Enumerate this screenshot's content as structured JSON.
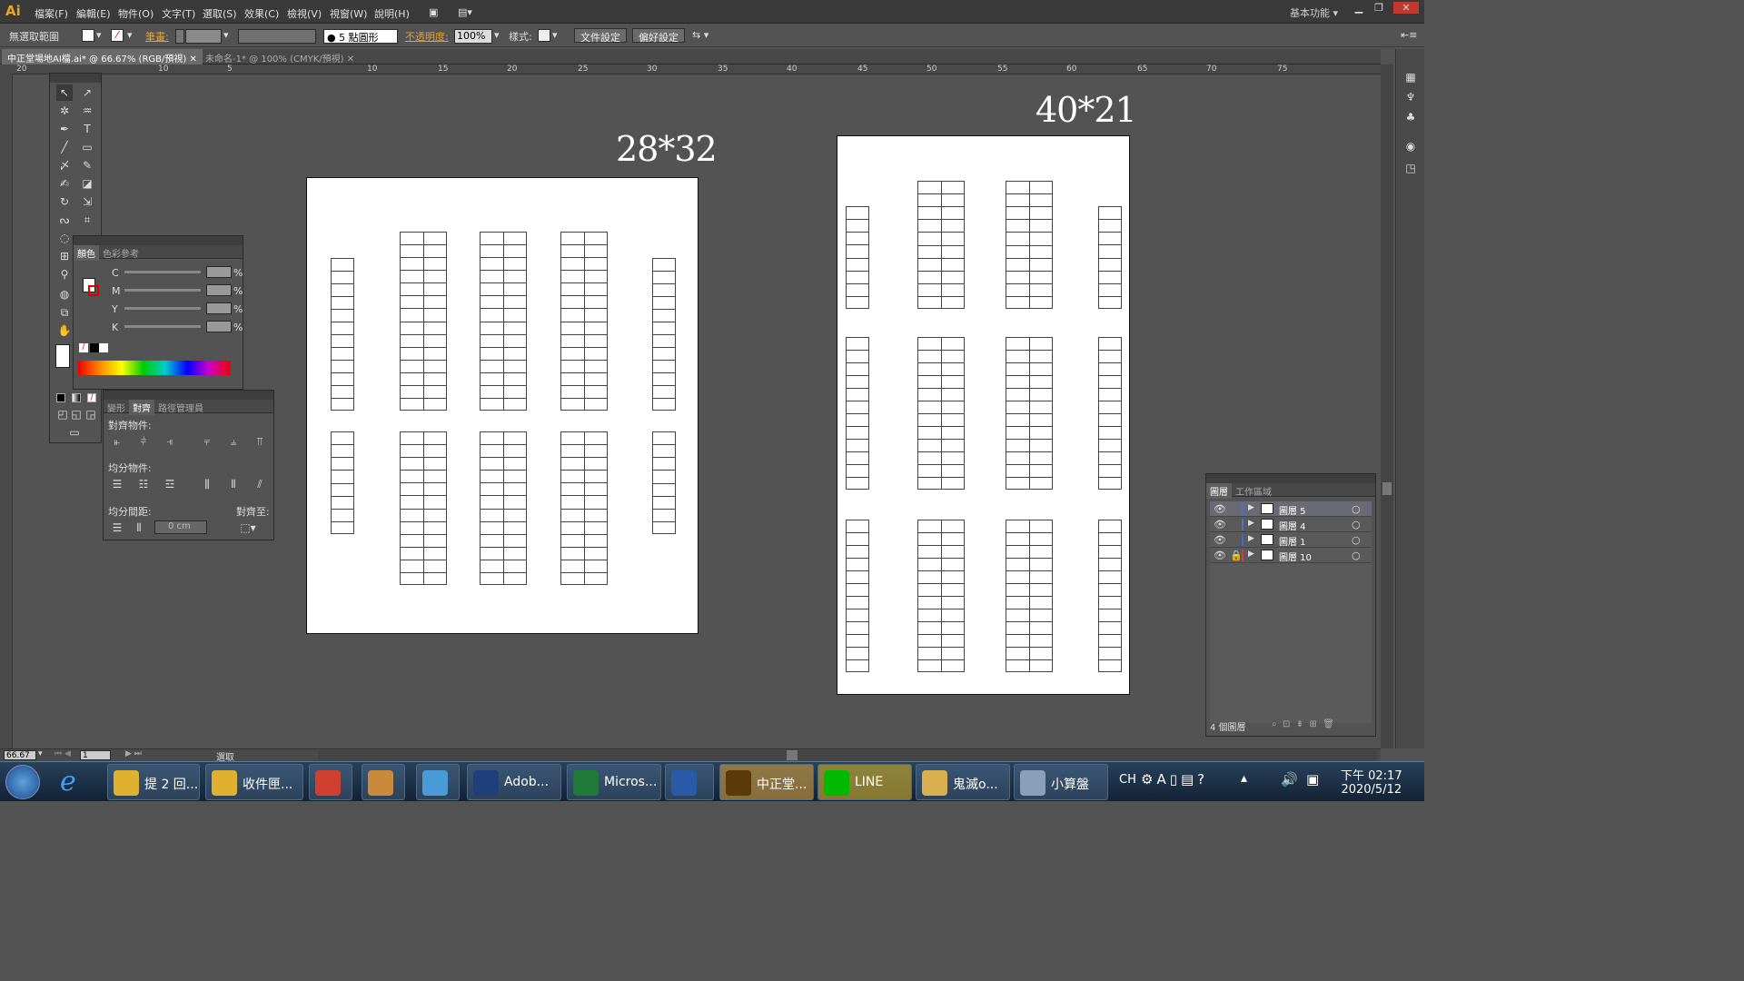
{
  "app": {
    "logo": "Ai",
    "workspace": "基本功能"
  },
  "menu": [
    "檔案(F)",
    "編輯(E)",
    "物件(O)",
    "文字(T)",
    "選取(S)",
    "效果(C)",
    "檢視(V)",
    "視窗(W)",
    "說明(H)"
  ],
  "control": {
    "selection": "無選取範圍",
    "stroke_label": "筆畫:",
    "brush": "5 點圓形",
    "opacity_label": "不透明度:",
    "opacity": "100%",
    "style_label": "樣式:",
    "doc_setup": "文件設定",
    "prefs": "偏好設定"
  },
  "tabs": [
    {
      "label": "中正堂場地AI檔.ai* @ 66.67% (RGB/預視)"
    },
    {
      "label": "未命名-1* @ 100% (CMYK/預視)"
    }
  ],
  "ruler": {
    "h": [
      "20",
      "10",
      "5",
      "10",
      "15",
      "20",
      "25",
      "30",
      "35",
      "40",
      "45",
      "50",
      "55",
      "60",
      "65",
      "70",
      "75"
    ]
  },
  "artboards": [
    {
      "label": "28*32"
    },
    {
      "label": "40*21"
    }
  ],
  "color_panel": {
    "tabs": [
      "顏色",
      "色彩參考"
    ],
    "channels": [
      "C",
      "M",
      "Y",
      "K"
    ],
    "unit": "%"
  },
  "align_panel": {
    "tabs": [
      "變形",
      "對齊",
      "路徑管理員"
    ],
    "align_objects": "對齊物件:",
    "distribute_objects": "均分物件:",
    "distribute_spacing": "均分間距:",
    "align_to": "對齊至:",
    "spacing_value": "0 cm"
  },
  "layers_panel": {
    "tabs": [
      "圖層",
      "工作區域"
    ],
    "layers": [
      {
        "name": "圖層 5",
        "color": "#4f6bd6"
      },
      {
        "name": "圖層 4",
        "color": "#4f6bd6"
      },
      {
        "name": "圖層 1",
        "color": "#3b6bd6"
      },
      {
        "name": "圖層 10",
        "color": "#d63b3b"
      }
    ],
    "count": "4 個圖層"
  },
  "status": {
    "zoom": "66.67",
    "page": "1",
    "mode": "選取"
  },
  "taskbar": {
    "apps": [
      {
        "label": "提 2 回...",
        "color": "#e0b030"
      },
      {
        "label": "收件匣...",
        "color": "#e0b030"
      },
      {
        "label": "",
        "color": "#d04030"
      },
      {
        "label": "",
        "color": "#c98a3a"
      },
      {
        "label": "",
        "color": "#4a9ad8"
      },
      {
        "label": "Adob...",
        "color": "#1e3f7a"
      },
      {
        "label": "Micros...",
        "color": "#1f7a3a"
      },
      {
        "label": "",
        "color": "#2a5aa8"
      },
      {
        "label": "中正堂...",
        "color": "#5a3a08"
      },
      {
        "label": "LINE",
        "color": "#00b900"
      },
      {
        "label": "鬼滅o...",
        "color": "#d8b050"
      },
      {
        "label": "小算盤",
        "color": "#8aa0b8"
      }
    ],
    "lang": "CH",
    "time": "下午 02:17",
    "date": "2020/5/12"
  }
}
